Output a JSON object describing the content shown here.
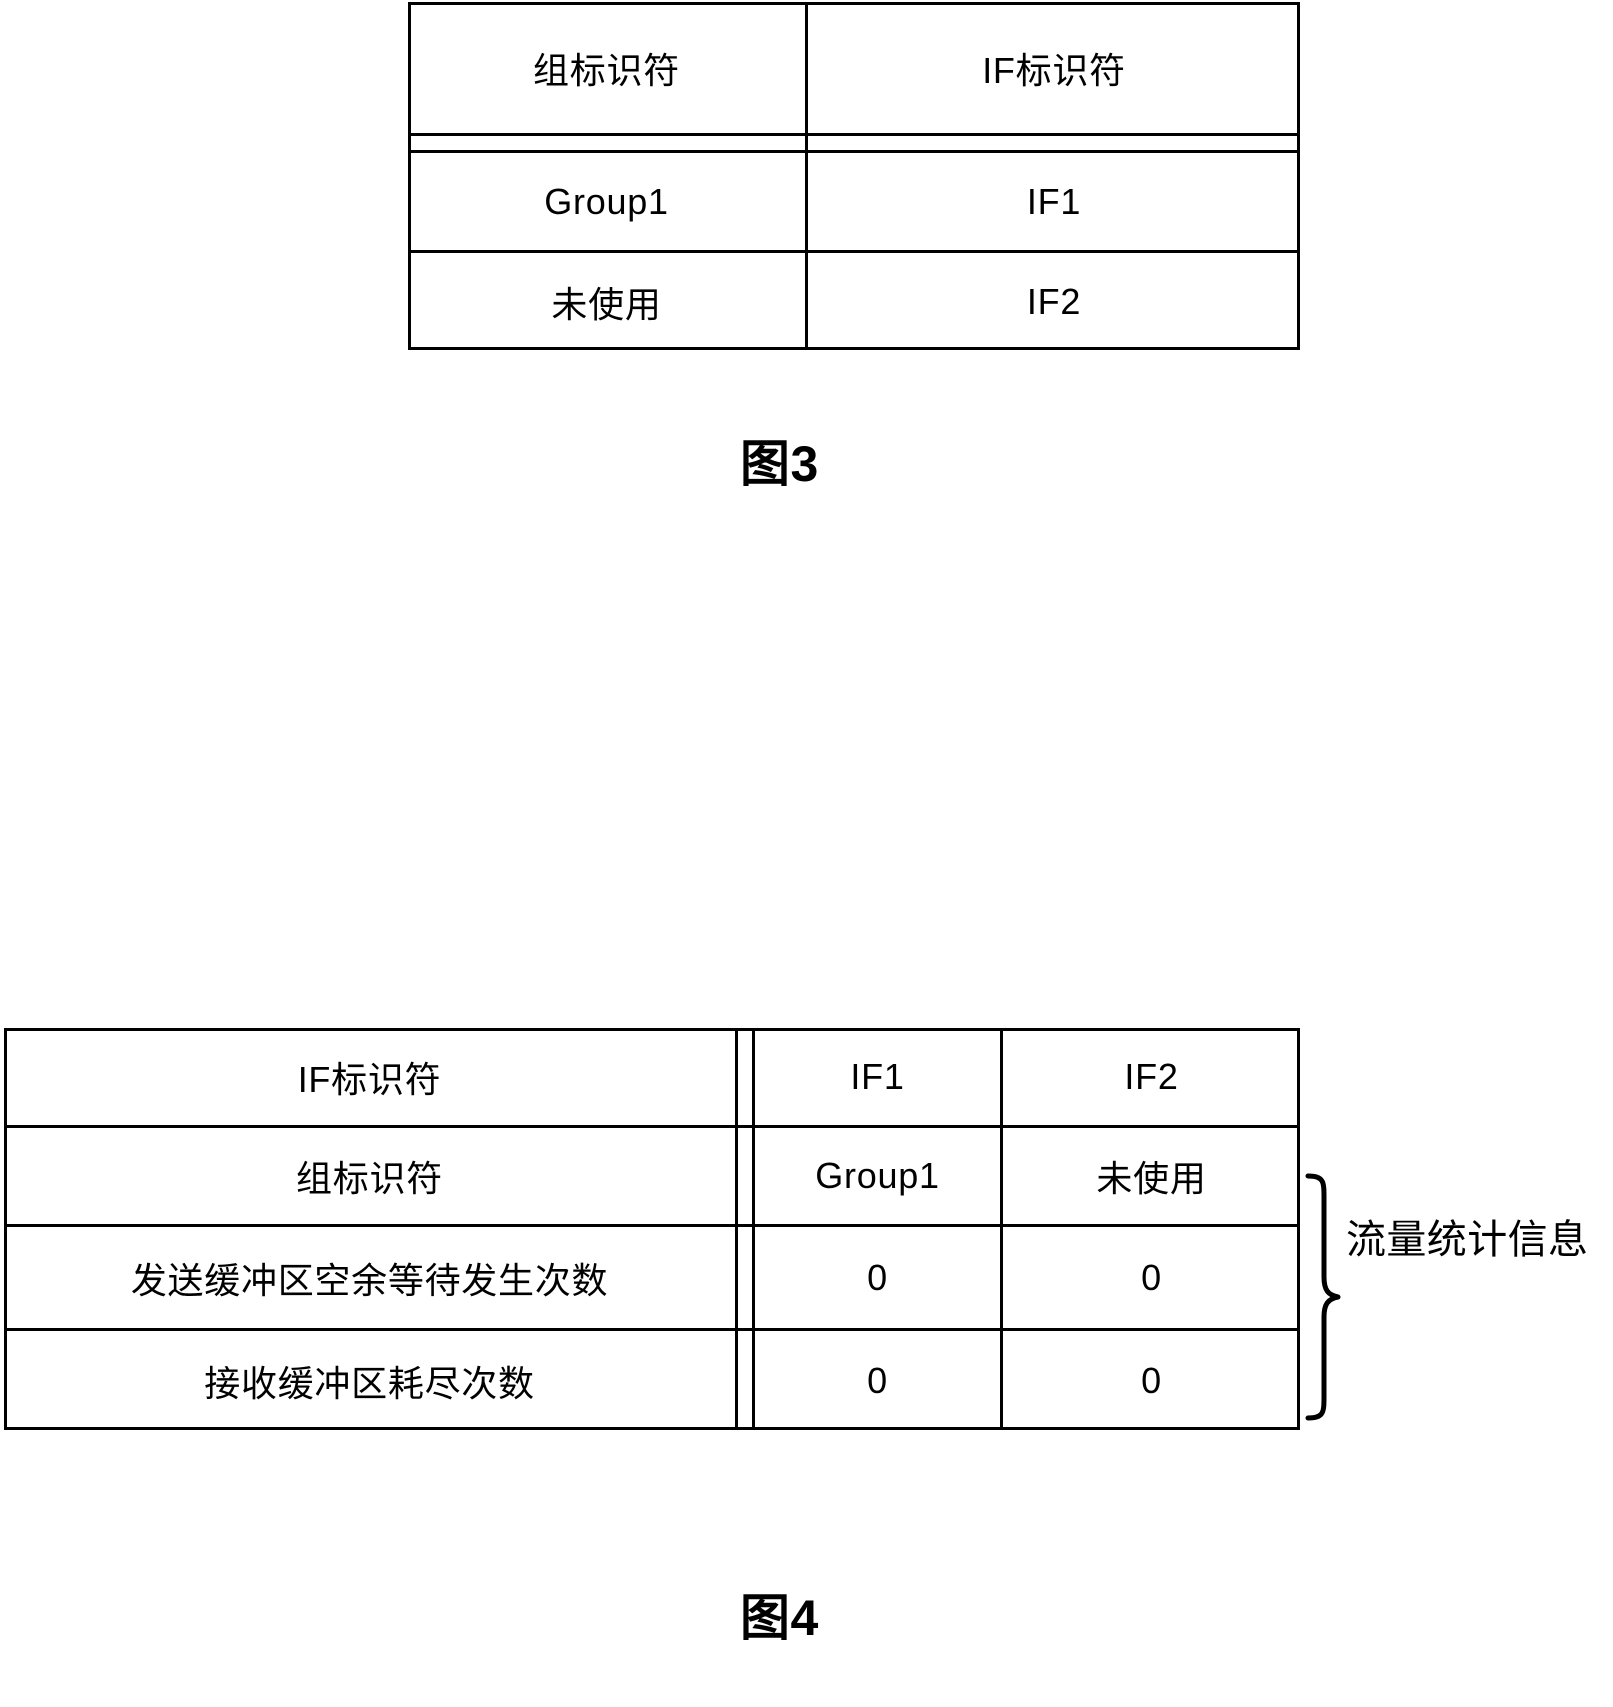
{
  "figure3": {
    "label": "图3",
    "table": {
      "headers": [
        "组标识符",
        "IF标识符"
      ],
      "rows": [
        [
          "Group1",
          "IF1"
        ],
        [
          "未使用",
          "IF2"
        ]
      ]
    }
  },
  "figure4": {
    "label": "图4",
    "table": {
      "row_labels": [
        "IF标识符",
        "组标识符",
        "发送缓冲区空余等待发生次数",
        "接收缓冲区耗尽次数"
      ],
      "columns": [
        [
          "IF1",
          "Group1",
          "0",
          "0"
        ],
        [
          "IF2",
          "未使用",
          "0",
          "0"
        ]
      ]
    },
    "annotation": {
      "brace_label": "流量统计信息"
    }
  },
  "colors": {
    "ink": "#000000",
    "paper": "#ffffff"
  }
}
